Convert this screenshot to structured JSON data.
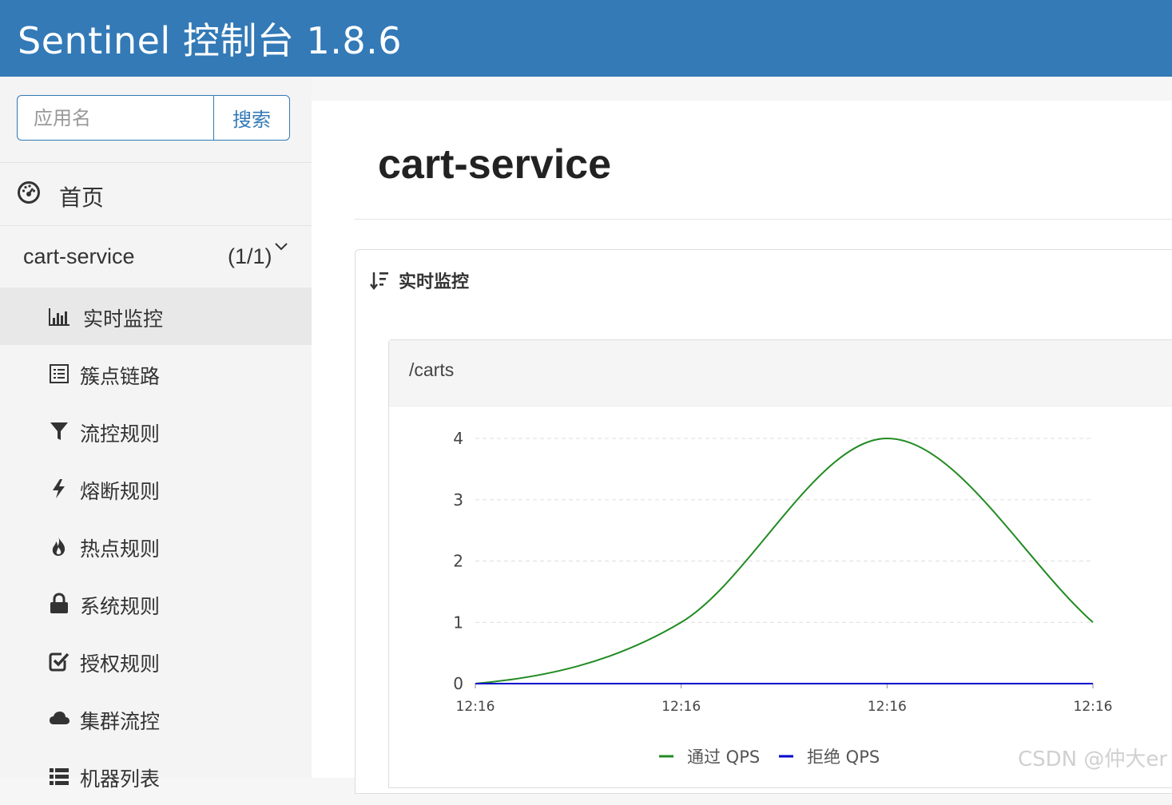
{
  "header": {
    "title": "Sentinel 控制台 1.8.6"
  },
  "sidebar": {
    "search": {
      "placeholder": "应用名",
      "button_label": "搜索"
    },
    "home": {
      "label": "首页",
      "icon": "dashboard-icon"
    },
    "app": {
      "name": "cart-service",
      "count": "(1/1)",
      "icon": "chevron-down-icon"
    },
    "items": [
      {
        "label": "实时监控",
        "icon": "bar-chart-icon",
        "active": true
      },
      {
        "label": "簇点链路",
        "icon": "list-icon"
      },
      {
        "label": "流控规则",
        "icon": "filter-icon"
      },
      {
        "label": "熔断规则",
        "icon": "lightning-icon"
      },
      {
        "label": "热点规则",
        "icon": "fire-icon"
      },
      {
        "label": "系统规则",
        "icon": "lock-icon"
      },
      {
        "label": "授权规则",
        "icon": "check-square-icon"
      },
      {
        "label": "集群流控",
        "icon": "cloud-icon"
      },
      {
        "label": "机器列表",
        "icon": "list-icon"
      }
    ]
  },
  "main": {
    "title": "cart-service",
    "panel_title": "实时监控",
    "panel_icon": "sort-icon",
    "card": {
      "resource": "/carts"
    }
  },
  "chart_data": {
    "type": "line",
    "x": [
      "12:16",
      "12:16",
      "12:16",
      "12:16"
    ],
    "series": [
      {
        "name": "通过 QPS",
        "color": "#228b22",
        "values": [
          0,
          1,
          4,
          1
        ]
      },
      {
        "name": "拒绝 QPS",
        "color": "#0000cd",
        "values": [
          0,
          0,
          0,
          0
        ]
      }
    ],
    "ylim": [
      0,
      4
    ],
    "yticks": [
      "0",
      "1",
      "2",
      "3",
      "4"
    ],
    "grid": true,
    "legend": "bottom-center"
  },
  "watermark": "CSDN @仲大er"
}
